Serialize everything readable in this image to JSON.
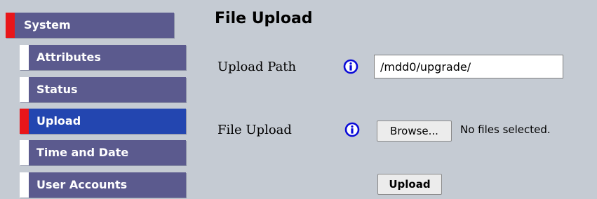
{
  "sidebar": {
    "items": [
      {
        "label": "System"
      },
      {
        "label": "Attributes"
      },
      {
        "label": "Status"
      },
      {
        "label": "Upload",
        "active": true
      },
      {
        "label": "Time and Date"
      },
      {
        "label": "User Accounts"
      }
    ]
  },
  "main": {
    "title": "File Upload",
    "upload_path": {
      "label": "Upload Path",
      "value": "/mdd0/upgrade/",
      "icon": "info-icon"
    },
    "file_upload": {
      "label": "File Upload",
      "browse_label": "Browse...",
      "status": "No files selected.",
      "icon": "info-icon"
    },
    "upload_button_label": "Upload"
  },
  "colors": {
    "background": "#c5cbd3",
    "nav_item": "#5b5a8e",
    "nav_item_active": "#2346b0",
    "marker_active": "#e8161a",
    "info_icon": "#0a0ad8"
  }
}
